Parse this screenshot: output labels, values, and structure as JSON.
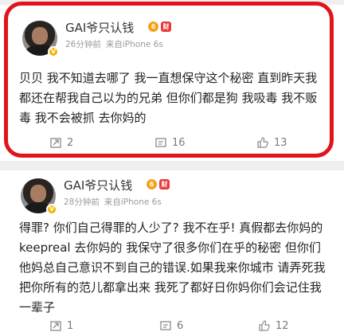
{
  "posts": [
    {
      "username": "GAI爷只认钱",
      "medal_level": "6",
      "medal_text": "财",
      "time": "26分钟前",
      "source": "来自iPhone 6s",
      "text": "贝贝 我不知道去哪了 我一直想保守这个秘密 直到昨天我都还在帮我自己以为的兄弟 但你们都是狗 我吸毒 我不贩毒 我不会被抓 去你妈的",
      "repost_count": "2",
      "comment_count": "16",
      "like_count": "13"
    },
    {
      "username": "GAI爷只认钱",
      "medal_level": "6",
      "medal_text": "财",
      "time": "28分钟前",
      "source": "来自iPhone 6s",
      "text": "得罪? 你们自己得罪的人少了? 我不在乎! 真假都去你妈的 keepreal 去你妈的 我保守了很多你们在乎的秘密 但你们他妈总自己意识不到自己的错误.如果我来你城市 请弄死我 把你所有的范儿都拿出来 我死了都好日你妈你们会记住我一辈子",
      "repost_count": "1",
      "comment_count": "6",
      "like_count": "12"
    }
  ],
  "highlight_color": "#e0141a"
}
